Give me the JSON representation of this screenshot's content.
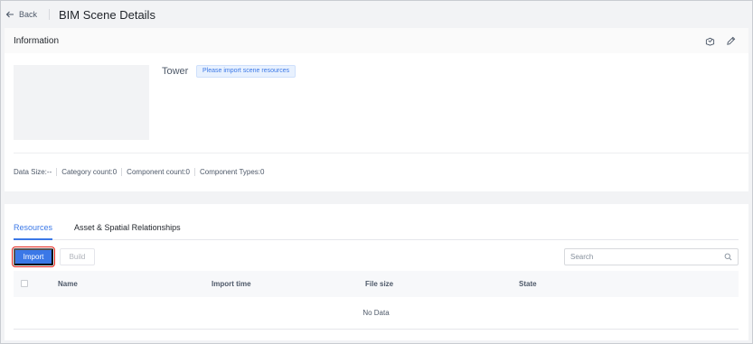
{
  "header": {
    "back_label": "Back",
    "title": "BIM Scene Details"
  },
  "info": {
    "title": "Information",
    "icons": [
      "package-icon",
      "edit-pencil-icon"
    ],
    "scene_name": "Tower",
    "tag": "Please import scene resources",
    "stats": {
      "data_size": "Data Size:--",
      "category_count": "Category count:0",
      "component_count": "Component count:0",
      "component_types": "Component Types:0"
    }
  },
  "resources": {
    "tabs": [
      {
        "label": "Resources",
        "active": true
      },
      {
        "label": "Asset & Spatial Relationships",
        "active": false
      }
    ],
    "import_label": "Import",
    "build_label": "Build",
    "search_placeholder": "Search",
    "columns": [
      "Name",
      "Import time",
      "File size",
      "State"
    ],
    "empty_text": "No Data"
  },
  "colors": {
    "accent": "#3b78e7",
    "highlight_border": "#e2231a",
    "page_bg": "#f2f3f5"
  }
}
